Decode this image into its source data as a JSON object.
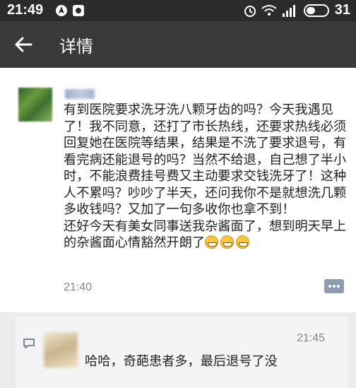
{
  "status_bar": {
    "time": "21:49",
    "battery": "31"
  },
  "app_bar": {
    "title": "详情"
  },
  "post": {
    "text": "有到医院要求洗牙洗八颗牙齿的吗？今天我遇见了！我不同意，还打了市长热线，还要求热线必须回复她在医院等结果，结果是不洗了要求退号，有看完病还能退号的吗？当然不给退，自己想了半小时，不能浪费挂号费又主动要求交钱洗牙了！这种人不累吗？吵吵了半天，还问我你不是就想洗几颗多收钱吗？又加了一句多收你也拿不到！\n还好今天有美女同事送我杂酱面了，想到明天早上的杂酱面心情豁然开朗了",
    "time": "21:40"
  },
  "comment": {
    "time": "21:45",
    "text": "哈哈，奇葩患者多，最后退号了没"
  },
  "icons": {
    "back": "arrow-left-icon",
    "comment": "comment-bubble-icon",
    "alarm": "alarm-icon",
    "wifi": "wifi-icon",
    "signal": "signal-icon",
    "battery": "battery-icon"
  }
}
